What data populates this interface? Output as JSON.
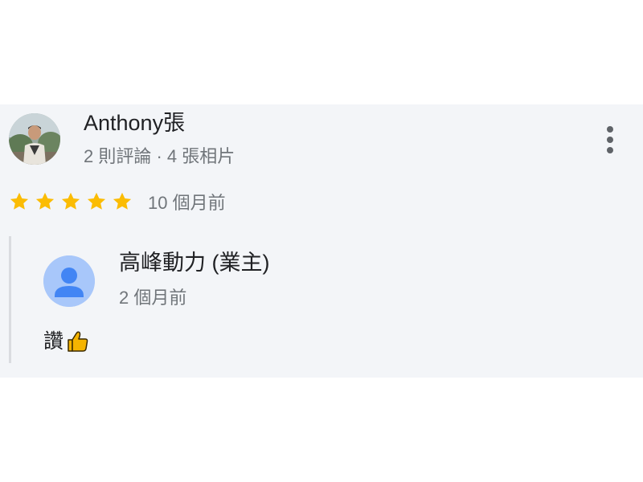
{
  "review": {
    "reviewer_name": "Anthony張",
    "reviewer_meta": "2 則評論 · 4 張相片",
    "rating": 5,
    "rating_max": 5,
    "date": "10 個月前",
    "star_color": "#fbbc04"
  },
  "owner_reply": {
    "name": "高峰動力 (業主)",
    "date": "2 個月前",
    "text": "讚",
    "emoji_icon": "thumbs-up-icon"
  },
  "icons": {
    "menu": "more-vertical-icon",
    "avatar": "user-photo",
    "owner_avatar": "default-person-icon"
  },
  "colors": {
    "card_background": "#f3f5f8",
    "owner_avatar_bg": "#a8c7fa",
    "owner_avatar_fg": "#4285f4"
  }
}
